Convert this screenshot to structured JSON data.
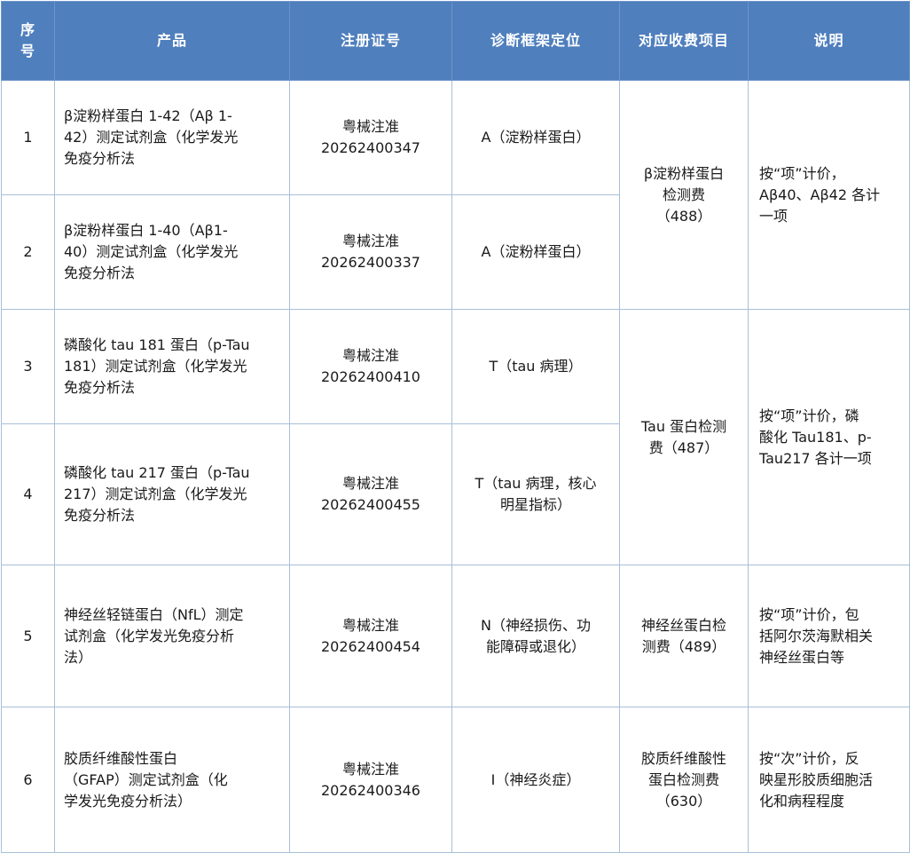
{
  "headers": {
    "idx_line1": "序",
    "idx_line2": "号",
    "product": "产品",
    "registration": "注册证号",
    "diagnosis": "诊断框架定位",
    "fee_item": "对应收费项目",
    "note": "说明"
  },
  "rows": [
    {
      "idx": "1",
      "product": [
        "β淀粉样蛋白 1-42（Aβ 1-",
        "42）测定试剂盒（化学发光",
        "免疫分析法"
      ],
      "reg": [
        "粤械注准",
        "20262400347"
      ],
      "diag": [
        "A（淀粉样蛋白）"
      ]
    },
    {
      "idx": "2",
      "product": [
        "β淀粉样蛋白 1-40（Aβ1-",
        "40）测定试剂盒（化学发光",
        "免疫分析法"
      ],
      "reg": [
        "粤械注准",
        "20262400337"
      ],
      "diag": [
        "A（淀粉样蛋白）"
      ]
    },
    {
      "idx": "3",
      "product": [
        "磷酸化 tau 181 蛋白（p-Tau",
        "181）测定试剂盒（化学发光",
        "免疫分析法"
      ],
      "reg": [
        "粤械注准",
        "20262400410"
      ],
      "diag": [
        "T（tau 病理）"
      ]
    },
    {
      "idx": "4",
      "product": [
        "磷酸化 tau 217 蛋白（p-Tau",
        "217）测定试剂盒（化学发光",
        "免疫分析法"
      ],
      "reg": [
        "粤械注准",
        "20262400455"
      ],
      "diag": [
        "T（tau 病理，核心",
        "明星指标）"
      ]
    },
    {
      "idx": "5",
      "product": [
        "神经丝轻链蛋白（NfL）测定",
        "试剂盒（化学发光免疫分析",
        "法）"
      ],
      "reg": [
        "粤械注准",
        "20262400454"
      ],
      "diag": [
        "N（神经损伤、功",
        "能障碍或退化）"
      ]
    },
    {
      "idx": "6",
      "product": [
        "胶质纤维酸性蛋白",
        "（GFAP）测定试剂盒（化",
        "学发光免疫分析法）"
      ],
      "reg": [
        "粤械注准",
        "20262400346"
      ],
      "diag": [
        "I（神经炎症）"
      ]
    }
  ],
  "fees": [
    [
      "β淀粉样蛋白",
      "检测费",
      "（488）"
    ],
    [
      "Tau 蛋白检测",
      "费（487）"
    ],
    [
      "神经丝蛋白检",
      "测费（489）"
    ],
    [
      "胶质纤维酸性",
      "蛋白检测费",
      "（630）"
    ]
  ],
  "notes": [
    [
      "按“项”计价，",
      "Aβ40、Aβ42 各计",
      "一项"
    ],
    [
      "按“项”计价，磷",
      "酸化 Tau181、p-",
      "Tau217 各计一项"
    ],
    [
      "按“项”计价，包",
      "括阿尔茨海默相关",
      "神经丝蛋白等"
    ],
    [
      "按“次”计价，反",
      "映星形胶质细胞活",
      "化和病程程度"
    ]
  ]
}
